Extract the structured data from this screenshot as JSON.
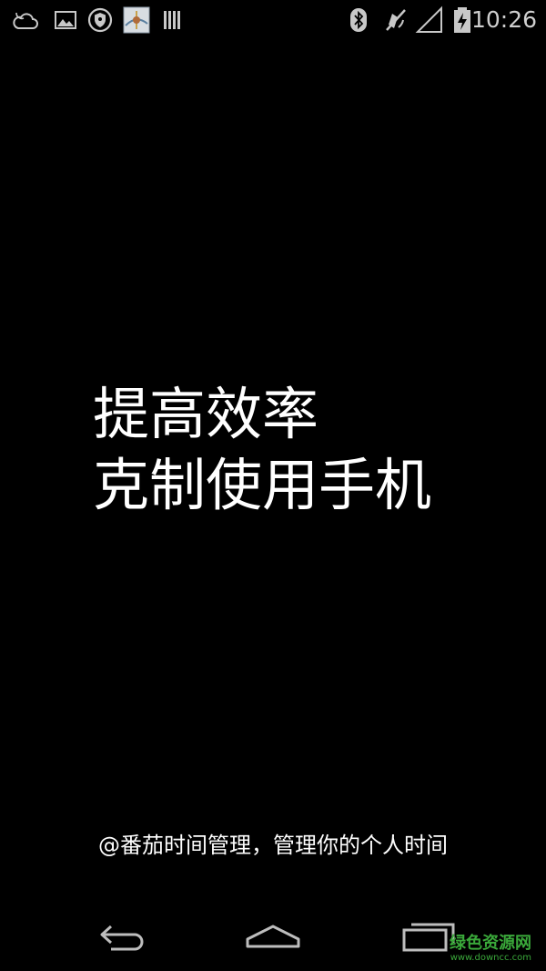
{
  "status_bar": {
    "left_icons": [
      "weather-cloud-icon",
      "image-icon",
      "vpn-shield-icon",
      "app-thumbnail-icon",
      "barcode-icon"
    ],
    "right_icons": [
      "bluetooth-icon",
      "muted-vibrate-icon",
      "signal-icon",
      "battery-charging-icon"
    ],
    "time": "10:26"
  },
  "splash": {
    "line1": "提高效率",
    "line2": "克制使用手机"
  },
  "tagline": "@番茄时间管理，管理你的个人时间",
  "nav_bar": {
    "buttons": [
      "back-button",
      "home-button",
      "recents-button"
    ]
  },
  "watermark": {
    "main": "绿色资源网",
    "sub": "www.downcc.com"
  },
  "colors": {
    "background": "#000000",
    "text": "#ffffff",
    "status_icons": "#c8c8c8",
    "watermark": "#3aa83a"
  }
}
